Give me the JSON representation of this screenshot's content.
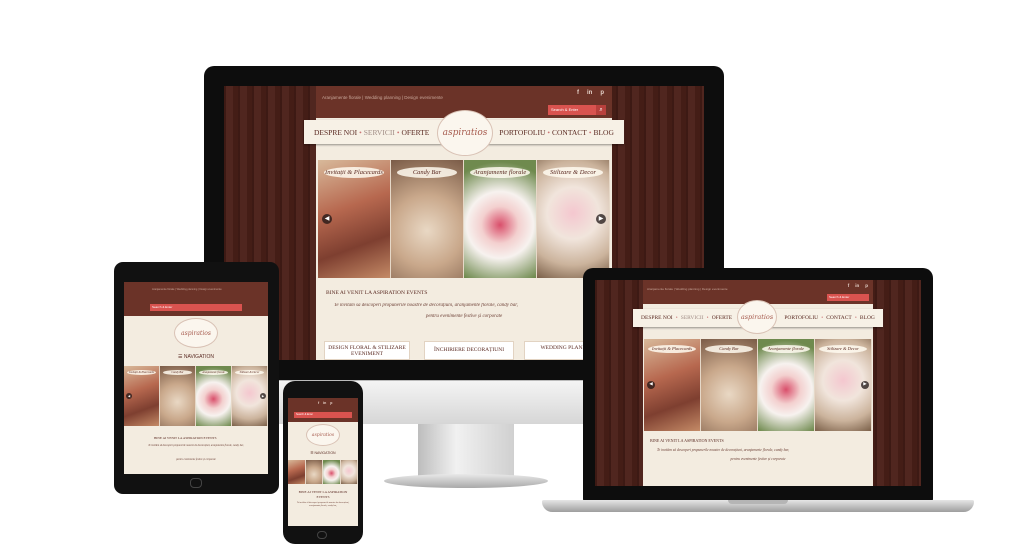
{
  "site": {
    "top_links": "Aranjamente florale | Wedding planning | Design evenimente",
    "search_placeholder": "Search & Enter",
    "search_icon": "search-icon",
    "social": [
      "f",
      "in",
      "p"
    ],
    "logo_text": "aspiratios",
    "nav_items": [
      "DESPRE NOI",
      "SERVICII",
      "OFERTE",
      "PORTOFOLIU",
      "CONTACT",
      "BLOG"
    ],
    "nav_separator": "•",
    "mobile_nav_label": "NAVIGATION",
    "slides": [
      "Invitații & Placecards",
      "Candy Bar",
      "Aranjamente florale",
      "Stilizare & Decor"
    ],
    "slides_tablet": [
      "Invitații & Placecards",
      "Candy Bar",
      "Aranjamente florale",
      "Stilizare & Decor"
    ],
    "welcome": "BINE AI VENIT LA ASPIRATION EVENTS",
    "intro_line1": "Te invităm să descoperi propunerile noastre de decorațiuni, aranjamente florale, candy bar,",
    "intro_line2": "pentru evenimente festive și corporate",
    "cta": [
      "DESIGN FLORAL & STILIZARE EVENIMENT",
      "ÎNCHIRIERE DECORAȚIUNI",
      "WEDDING PLANNER"
    ]
  },
  "colors": {
    "wood": "#4a1f18",
    "topbar": "#6b3328",
    "paper": "#f3ece0",
    "accent": "#d9534f",
    "text": "#5a2a22"
  }
}
